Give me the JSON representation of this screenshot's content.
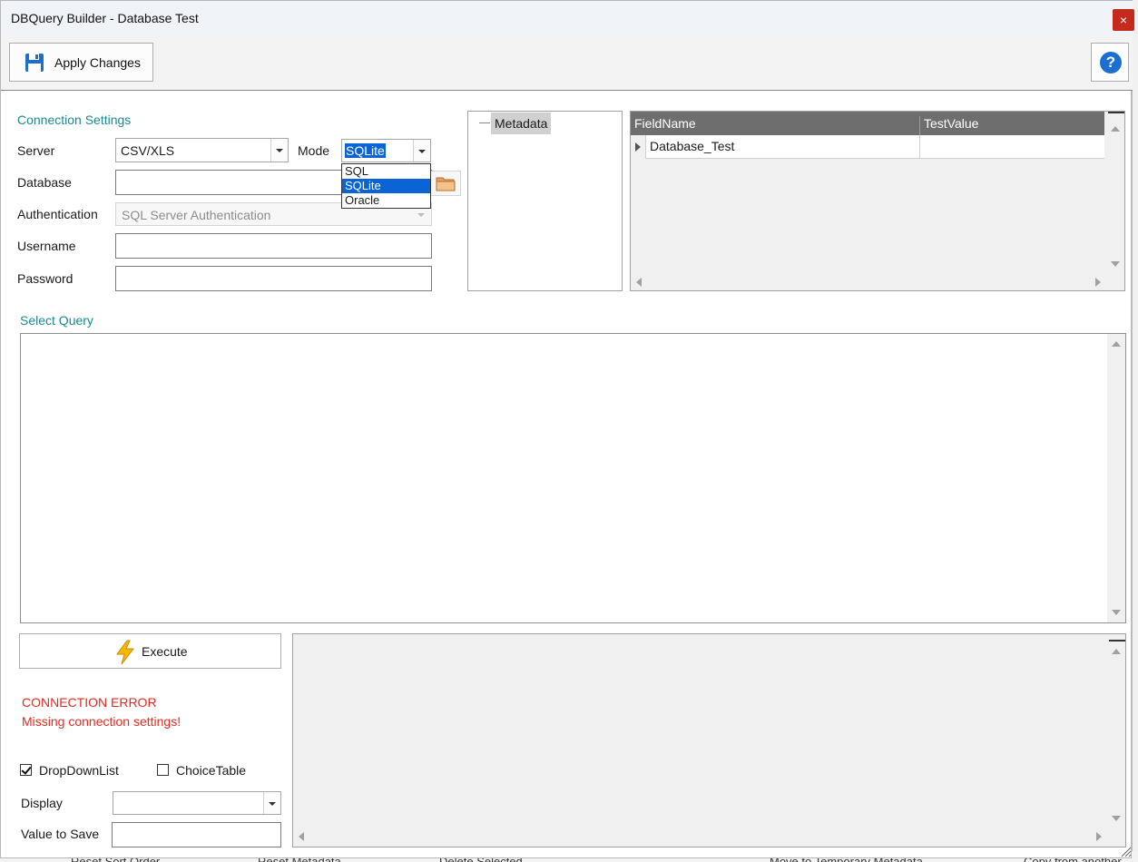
{
  "window": {
    "title": "DBQuery Builder - Database Test",
    "close_label": "×"
  },
  "toolbar": {
    "apply_label": "Apply Changes",
    "help_label": "?"
  },
  "connection": {
    "section_label": "Connection Settings",
    "server_label": "Server",
    "server_value": "CSV/XLS",
    "mode_label": "Mode",
    "mode_value": "SQLite",
    "mode_options": [
      "SQL",
      "SQLite",
      "Oracle"
    ],
    "database_label": "Database",
    "database_value": "",
    "auth_label": "Authentication",
    "auth_value": "SQL Server Authentication",
    "username_label": "Username",
    "username_value": "",
    "password_label": "Password",
    "password_value": ""
  },
  "tree": {
    "root": "Metadata"
  },
  "grid": {
    "columns": [
      "FieldName",
      "TestValue"
    ],
    "rows": [
      {
        "field": "Database_Test",
        "value": ""
      }
    ]
  },
  "query": {
    "section_label": "Select Query",
    "text": ""
  },
  "execute": {
    "label": "Execute"
  },
  "status": {
    "error_title": "CONNECTION ERROR",
    "error_message": "Missing connection settings!"
  },
  "options": {
    "dropdownlist_label": "DropDownList",
    "dropdownlist_checked": true,
    "choicetable_label": "ChoiceTable",
    "choicetable_checked": false,
    "display_label": "Display",
    "display_value": "",
    "value_to_save_label": "Value to Save",
    "value_to_save_value": ""
  },
  "background_toolbar": {
    "items": [
      "Reset Sort Order",
      "Reset Metadata",
      "Delete Selected",
      "Move to Temporary Metadata",
      "Copy from another"
    ]
  },
  "colors": {
    "accent_teal": "#1a8a8f",
    "error_red": "#e8281f",
    "selection_blue": "#0a64d6",
    "close_red": "#c42b1c"
  }
}
